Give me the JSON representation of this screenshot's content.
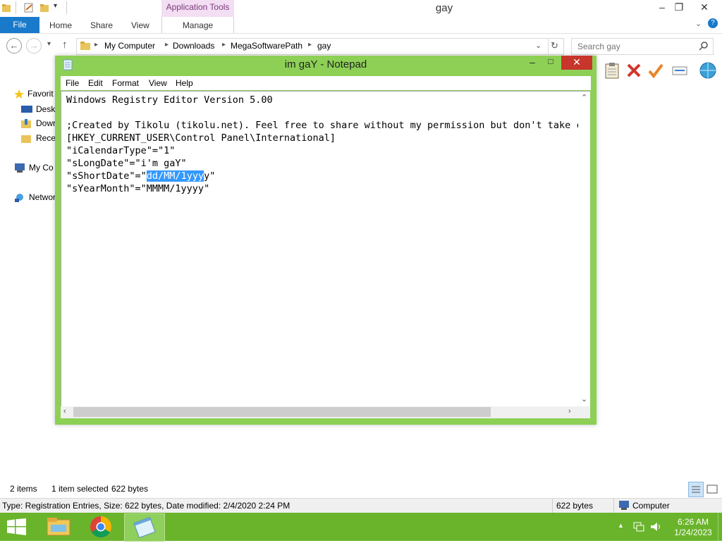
{
  "explorer": {
    "title": "gay",
    "ribbon": {
      "context_label": "Application Tools",
      "tabs": [
        "File",
        "Home",
        "Share",
        "View",
        "Manage"
      ]
    },
    "address": {
      "crumbs": [
        "My Computer",
        "Downloads",
        "MegaSoftwarePath",
        "gay"
      ]
    },
    "search": {
      "placeholder": "Search gay"
    },
    "nav_pane": [
      "Favorit",
      "Deskt",
      "Dowr",
      "Recer",
      "My Co",
      "Networ"
    ],
    "status": {
      "items": "2 items",
      "selected": "1 item selected",
      "size": "622 bytes"
    },
    "details": {
      "text": "Type: Registration Entries, Size: 622 bytes, Date modified: 2/4/2020 2:24 PM",
      "size": "622 bytes",
      "location": "Computer"
    }
  },
  "notepad": {
    "title": "im gaY - Notepad",
    "menus": [
      "File",
      "Edit",
      "Format",
      "View",
      "Help"
    ],
    "lines": {
      "l1": "Windows Registry Editor Version 5.00",
      "l2": ";Created by Tikolu (tikolu.net). Feel free to share without my permission but don't take cr",
      "l3": "[HKEY_CURRENT_USER\\Control Panel\\International]",
      "l4": "\"iCalendarType\"=\"1\"",
      "l5": "\"sLongDate\"=\"i'm gaY\"",
      "l6_pre": "\"sShortDate\"=\"",
      "l6_sel": "dd/MM/1yyy",
      "l6_post": "y\"",
      "l7": "\"sYearMonth\"=\"MMMM/1yyyy\""
    }
  },
  "taskbar": {
    "time": "6:26 AM",
    "date": "1/24/2023"
  }
}
